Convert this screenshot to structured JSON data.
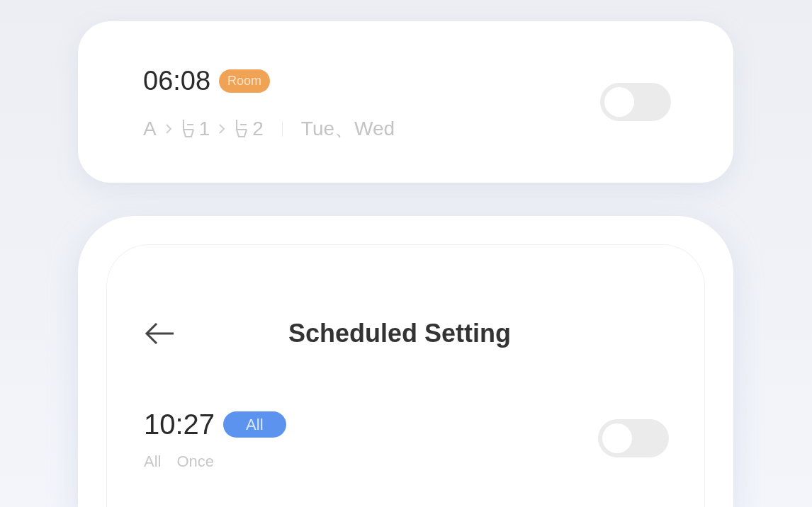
{
  "card": {
    "time": "06:08",
    "tag": {
      "label": "Room",
      "kind": "room"
    },
    "path": [
      {
        "kind": "text",
        "label": "A"
      },
      {
        "kind": "seat",
        "label": "1"
      },
      {
        "kind": "seat",
        "label": "2"
      }
    ],
    "days": "Tue、Wed",
    "on": false
  },
  "screen": {
    "title": "Scheduled Setting",
    "schedules": [
      {
        "time": "10:27",
        "tag": {
          "label": "All",
          "kind": "all"
        },
        "details": [
          "All",
          "Once"
        ],
        "on": false
      }
    ]
  }
}
